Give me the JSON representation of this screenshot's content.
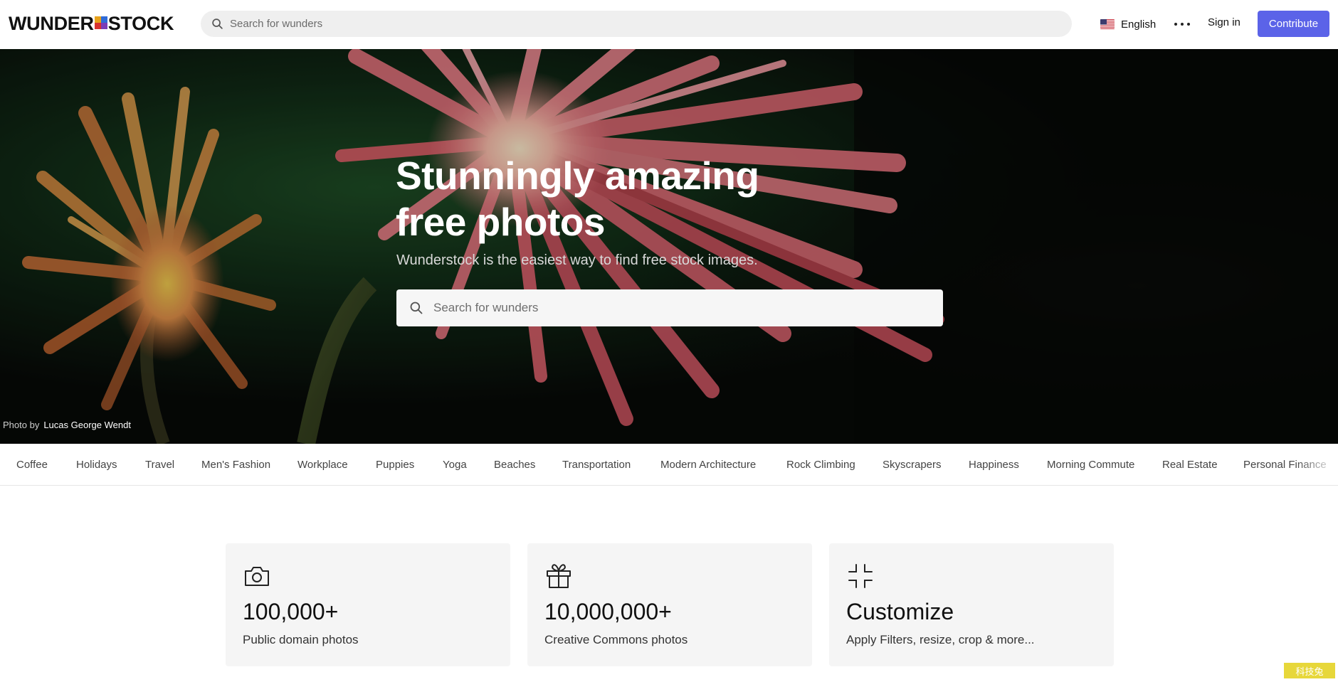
{
  "header": {
    "logo_left": "WUNDER",
    "logo_right": "STOCK",
    "search_placeholder": "Search for wunders",
    "language": "English",
    "signin": "Sign in",
    "contribute": "Contribute",
    "contribute_color": "#5b63e8"
  },
  "hero": {
    "title_line1": "Stunningly amazing",
    "title_line2": "free photos",
    "subtitle": "Wunderstock is the easiest way to find free stock images.",
    "search_placeholder": "Search for wunders",
    "credit_prefix": "Photo by",
    "credit_name": "Lucas George Wendt"
  },
  "categories": [
    "Coffee",
    "Holidays",
    "Travel",
    "Men's Fashion",
    "Workplace",
    "Puppies",
    "Yoga",
    "Beaches",
    "Transportation",
    "Modern Architecture",
    "Rock Climbing",
    "Skyscrapers",
    "Happiness",
    "Morning Commute",
    "Real Estate",
    "Personal Finance"
  ],
  "features": [
    {
      "icon": "camera-icon",
      "value": "100,000+",
      "desc": "Public domain photos"
    },
    {
      "icon": "gift-icon",
      "value": "10,000,000+",
      "desc": "Creative Commons photos"
    },
    {
      "icon": "compress-icon",
      "value": "Customize",
      "desc": "Apply Filters, resize, crop & more..."
    }
  ],
  "watermark": "科技兔"
}
